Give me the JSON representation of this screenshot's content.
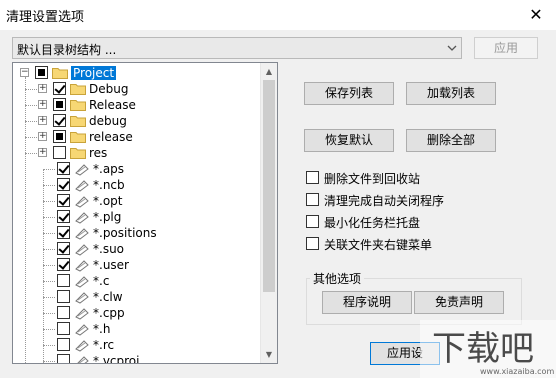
{
  "window": {
    "title": "清理设置选项",
    "close_label": "✕"
  },
  "combo": {
    "value": "默认目录树结构 ..."
  },
  "buttons": {
    "apply_top": "应用",
    "save_list": "保存列表",
    "load_list": "加载列表",
    "restore_default": "恢复默认",
    "delete_all": "删除全部",
    "about": "程序说明",
    "disclaimer": "免责声明",
    "apply_bottom": "应用设"
  },
  "options": [
    {
      "label": "删除文件到回收站",
      "checked": false
    },
    {
      "label": "清理完成自动关闭程序",
      "checked": false
    },
    {
      "label": "最小化任务栏托盘",
      "checked": false
    },
    {
      "label": "关联文件夹右键菜单",
      "checked": false
    }
  ],
  "group": {
    "title": "其他选项"
  },
  "tree": {
    "root": {
      "label": "Project",
      "state": "partial"
    },
    "folders": [
      {
        "label": "Debug",
        "state": "checked"
      },
      {
        "label": "Release",
        "state": "partial"
      },
      {
        "label": "debug",
        "state": "checked"
      },
      {
        "label": "release",
        "state": "partial"
      },
      {
        "label": "res",
        "state": "unchecked"
      }
    ],
    "files": [
      {
        "label": "*.aps",
        "state": "checked"
      },
      {
        "label": "*.ncb",
        "state": "checked"
      },
      {
        "label": "*.opt",
        "state": "checked"
      },
      {
        "label": "*.plg",
        "state": "checked"
      },
      {
        "label": "*.positions",
        "state": "checked"
      },
      {
        "label": "*.suo",
        "state": "checked"
      },
      {
        "label": "*.user",
        "state": "checked"
      },
      {
        "label": "*.c",
        "state": "unchecked"
      },
      {
        "label": "*.clw",
        "state": "unchecked"
      },
      {
        "label": "*.cpp",
        "state": "unchecked"
      },
      {
        "label": "*.h",
        "state": "unchecked"
      },
      {
        "label": "*.rc",
        "state": "unchecked"
      },
      {
        "label": "*.vcproj",
        "state": "unchecked"
      }
    ]
  },
  "watermark": {
    "text": "下载吧",
    "url_text": "www.xiazaiba.com"
  }
}
